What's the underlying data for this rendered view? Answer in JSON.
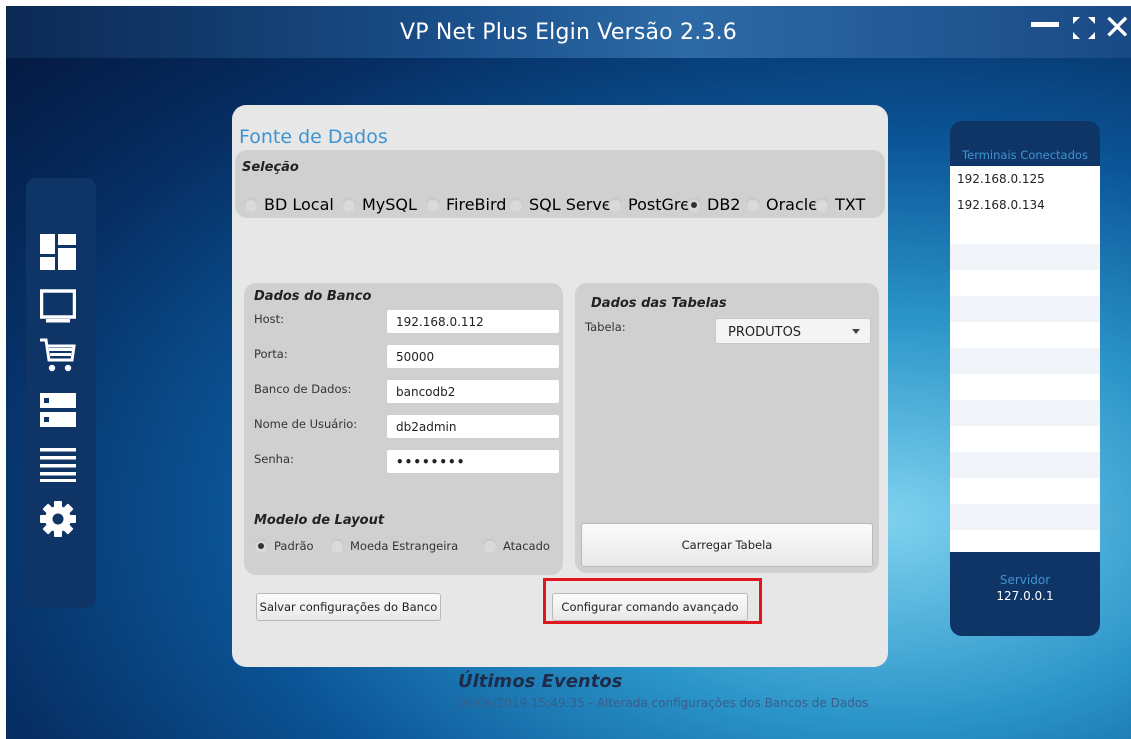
{
  "window": {
    "title": "VP Net Plus Elgin Versão 2.3.6"
  },
  "sidebar": {
    "icons": [
      "dashboard-icon",
      "monitor-icon",
      "cart-icon",
      "server-icon",
      "list-icon",
      "gear-icon"
    ]
  },
  "fonte": {
    "title": "Fonte de Dados",
    "selecao_label": "Seleção",
    "databases": [
      {
        "label": "BD Local",
        "selected": false
      },
      {
        "label": "MySQL",
        "selected": false
      },
      {
        "label": "FireBird",
        "selected": false
      },
      {
        "label": "SQL Server",
        "selected": false
      },
      {
        "label": "PostGre",
        "selected": false
      },
      {
        "label": "DB2",
        "selected": true
      },
      {
        "label": "Oracle",
        "selected": false
      },
      {
        "label": "TXT",
        "selected": false
      }
    ]
  },
  "banco": {
    "title": "Dados do Banco",
    "fields": [
      {
        "label": "Host:",
        "value": "192.168.0.112"
      },
      {
        "label": "Porta:",
        "value": "50000"
      },
      {
        "label": "Banco de Dados:",
        "value": "bancodb2"
      },
      {
        "label": "Nome de Usuário:",
        "value": "db2admin"
      },
      {
        "label": "Senha:",
        "value": "••••••••"
      }
    ],
    "layout_title": "Modelo de Layout",
    "layouts": [
      {
        "label": "Padrão",
        "selected": true
      },
      {
        "label": "Moeda Estrangeira",
        "selected": false
      },
      {
        "label": "Atacado",
        "selected": false
      }
    ]
  },
  "tabelas": {
    "title": "Dados das Tabelas",
    "tabela_label": "Tabela:",
    "tabela_value": "PRODUTOS",
    "carregar_label": "Carregar Tabela"
  },
  "actions": {
    "salvar_label": "Salvar configurações do Banco",
    "configurar_label": "Configurar comando avançado"
  },
  "terminais": {
    "header": "Terminais Conectados",
    "items": [
      "192.168.0.125",
      "192.168.0.134"
    ],
    "servidor_label": "Servidor",
    "servidor_ip": "127.0.0.1"
  },
  "eventos": {
    "title": "Últimos Eventos",
    "items": [
      "06/06/2019 15:49:35 - Alterada configurações dos Bancos de Dados"
    ]
  },
  "colors": {
    "accent": "#3f93d2",
    "sidebar": "#0f3566",
    "highlight": "#e1171f"
  }
}
